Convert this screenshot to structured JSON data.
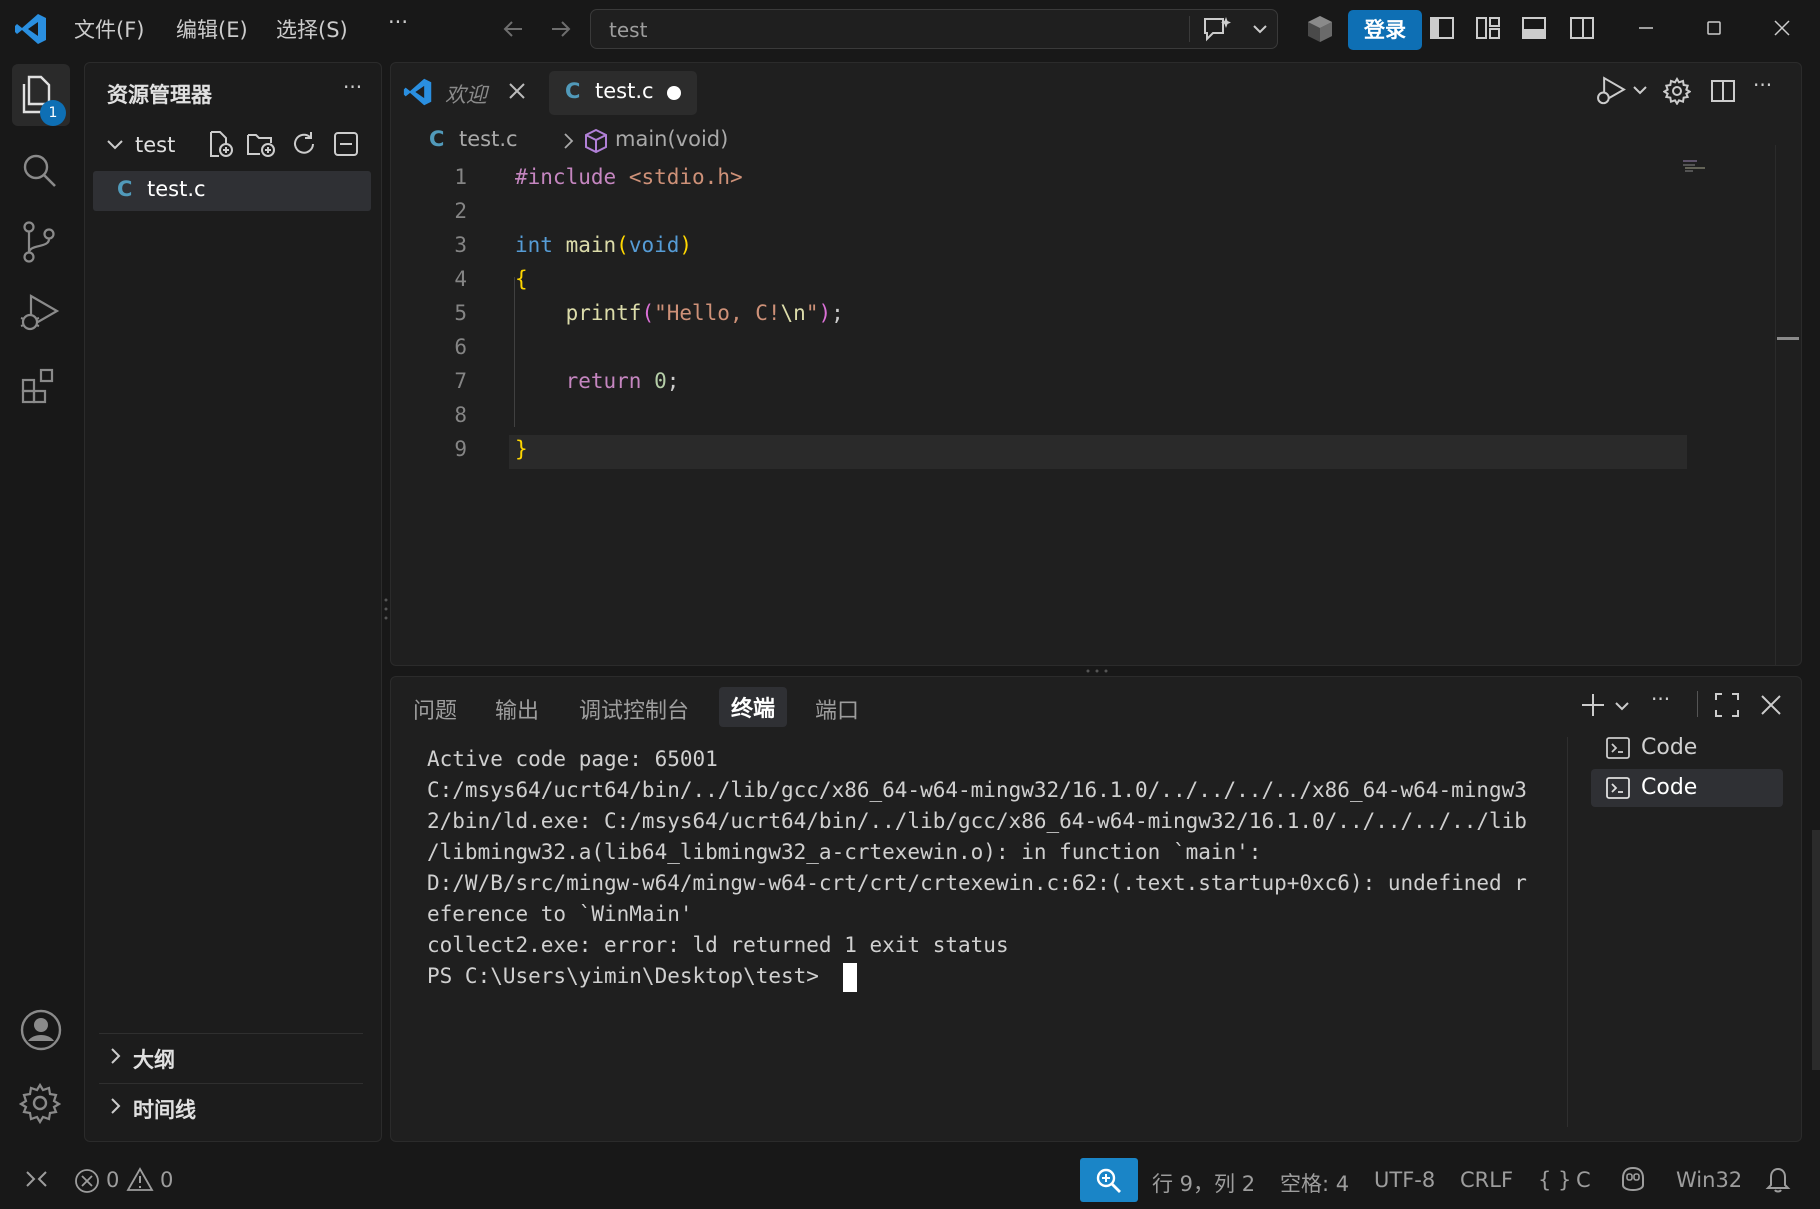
{
  "title_bar": {
    "menus": [
      "文件(F)",
      "编辑(E)",
      "选择(S)"
    ],
    "more": "···",
    "search_text": "test",
    "login_label": "登录"
  },
  "activity_bar": {
    "explorer_badge": "1"
  },
  "sidebar": {
    "title": "资源管理器",
    "more": "···",
    "folder_name": "test",
    "file_name": "test.c",
    "file_icon": "C",
    "sections": [
      "大纲",
      "时间线"
    ]
  },
  "editor": {
    "tabs": [
      {
        "label": "欢迎",
        "icon": "vscode-logo"
      },
      {
        "label": "test.c",
        "icon": "C"
      }
    ],
    "breadcrumb": {
      "file": "test.c",
      "file_icon": "C",
      "symbol": "main(void)"
    },
    "lines": [
      {
        "n": "1",
        "text": "#include <stdio.h>"
      },
      {
        "n": "2",
        "text": ""
      },
      {
        "n": "3",
        "text": "int main(void)"
      },
      {
        "n": "4",
        "text": "{"
      },
      {
        "n": "5",
        "text": "    printf(\"Hello, C!\\n\");"
      },
      {
        "n": "6",
        "text": ""
      },
      {
        "n": "7",
        "text": "    return 0;"
      },
      {
        "n": "8",
        "text": ""
      },
      {
        "n": "9",
        "text": "}"
      }
    ]
  },
  "panel": {
    "tabs": [
      "问题",
      "输出",
      "调试控制台",
      "终端",
      "端口"
    ],
    "active_tab": "终端",
    "terminal_lines": [
      "Active code page: 65001",
      "C:/msys64/ucrt64/bin/../lib/gcc/x86_64-w64-mingw32/16.1.0/../../../../x86_64-w64-mingw3",
      "2/bin/ld.exe: C:/msys64/ucrt64/bin/../lib/gcc/x86_64-w64-mingw32/16.1.0/../../../../lib",
      "/libmingw32.a(lib64_libmingw32_a-crtexewin.o): in function `main':",
      "D:/W/B/src/mingw-w64/mingw-w64-crt/crt/crtexewin.c:62:(.text.startup+0xc6): undefined r",
      "eference to `WinMain'",
      "collect2.exe: error: ld returned 1 exit status",
      "PS C:\\Users\\yimin\\Desktop\\test> "
    ],
    "terminals": [
      "Code",
      "Code"
    ]
  },
  "status_bar": {
    "errors": "0",
    "warnings": "0",
    "position": "行 9，列 2",
    "spaces": "空格: 4",
    "encoding": "UTF-8",
    "eol": "CRLF",
    "language": "C",
    "language_braces": "{ }",
    "platform": "Win32"
  },
  "colors": {
    "accent": "#0e6fb4",
    "background": "#181818",
    "editor_bg": "#1f1f1f"
  }
}
